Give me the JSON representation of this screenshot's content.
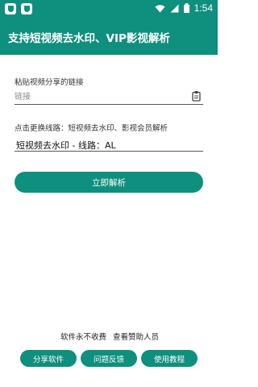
{
  "status_bar": {
    "time": "1:54",
    "icons": [
      "shield-app-icon",
      "shield-app-icon",
      "wifi-icon",
      "signal-icon",
      "battery-icon"
    ]
  },
  "app_bar": {
    "title": "支持短视频去水印、VIP影视解析"
  },
  "link_section": {
    "label": "粘贴视频分享的链接",
    "input_placeholder": "链接",
    "input_value": "",
    "paste_icon": "clipboard-icon"
  },
  "route_section": {
    "label": "点击更换线路：短视频去水印、影视会员解析",
    "selected": "短视频去水印 - 线路：AL"
  },
  "primary_button": {
    "label": "立即解析"
  },
  "footer": {
    "free_text": "软件永不收费",
    "sponsors_link": "查看赞助人员",
    "buttons": [
      "分享软件",
      "问题反馈",
      "使用教程"
    ]
  },
  "colors": {
    "primary": "#0f8f7e",
    "text": "#222222"
  }
}
